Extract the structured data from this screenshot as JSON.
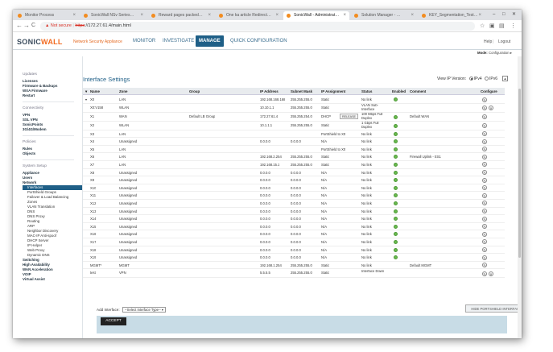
{
  "browser": {
    "tabs": [
      {
        "label": "Monitor Process"
      },
      {
        "label": "SonicWall NSv Series…"
      },
      {
        "label": "Reward pages packed…"
      },
      {
        "label": "One ka article Redirect…"
      },
      {
        "label": "SonicWall - Administrat…"
      },
      {
        "label": "Solution Manager - …"
      },
      {
        "label": "KEY_Segmentation_Test…"
      }
    ],
    "security_label": "Not secure",
    "url_scheme": "https",
    "url_rest": "://172.27.61.4/main.html",
    "back": "←",
    "forward": "→",
    "reload": "C"
  },
  "header": {
    "logo_a": "SONIC",
    "logo_b": "WALL",
    "product": "Network Security Appliance",
    "nav": [
      "MONITOR",
      "INVESTIGATE",
      "MANAGE",
      "QUICK CONFIGURATION"
    ],
    "help": "Help",
    "logout": "Logout"
  },
  "mode": {
    "label": "Mode:",
    "value": "Configuration ▸"
  },
  "sidebar": {
    "updates": "Updates",
    "updates_items": [
      "Licenses",
      "Firmware & Backups",
      "WXA Firmware",
      "Restart"
    ],
    "connectivity": "Connectivity",
    "connectivity_items": [
      "VPN",
      "SSL VPN",
      "SonicPoints",
      "3G/4G/Modem"
    ],
    "policies": "Policies",
    "policies_items": [
      "Rules",
      "Objects"
    ],
    "system_setup": "System Setup",
    "sys_items": [
      "Appliance",
      "Users",
      "Network"
    ],
    "network_items": [
      "Interfaces",
      "PortShield Groups",
      "Failover & Load Balancing",
      "Zones",
      "VLAN Translation",
      "DNS",
      "DNS Proxy",
      "Routing",
      "ARP",
      "Neighbor Discovery",
      "MAC-IP Anti-spoof",
      "DHCP Server",
      "IP Helper",
      "Web Proxy",
      "Dynamic DNS"
    ],
    "bottom_items": [
      "Switching",
      "High Availability",
      "WAN Acceleration",
      "VOIP",
      "Virtual Assist"
    ]
  },
  "page": {
    "title": "Interface Settings",
    "ip_version_label": "View IP Version:",
    "ipv4": "IPv4",
    "ipv6": "IPv6",
    "selected_ip_version": "IPv4",
    "columns": [
      "Name",
      "Zone",
      "Group",
      "IP Address",
      "Subnet Mask",
      "IP Assignment",
      "Status",
      "Enabled",
      "Comment",
      "Configure"
    ],
    "rows": [
      {
        "name": "X0",
        "zone": "LAN",
        "group": "",
        "ip": "192.168.168.168",
        "mask": "255.255.255.0",
        "assign": "Static",
        "status": "No link",
        "enabled": true,
        "comment": "",
        "del": false,
        "expand": true
      },
      {
        "name": "X0:V158",
        "zone": "WLAN",
        "group": "",
        "ip": "10.10.1.1",
        "mask": "255.255.255.0",
        "assign": "Static",
        "status": "VLAN Sub-Interface",
        "enabled": false,
        "comment": "",
        "del": true,
        "indent": true
      },
      {
        "name": "X1",
        "zone": "WAN",
        "group": "Default LB Group",
        "ip": "172.27.61.4",
        "mask": "255.255.254.0",
        "assign": "DHCP",
        "release": "RELEASE",
        "status": "100 Mbps Full Duplex",
        "enabled": true,
        "comment": "Default WAN",
        "del": false
      },
      {
        "name": "X2",
        "zone": "WLAN",
        "group": "",
        "ip": "10.1.1.1",
        "mask": "255.255.255.0",
        "assign": "Static",
        "status": "1 Gbps Full Duplex",
        "enabled": true,
        "comment": "",
        "del": false
      },
      {
        "name": "X3",
        "zone": "LAN",
        "group": "",
        "ip": "",
        "mask": "",
        "assign": "PortShield to X0",
        "status": "No link",
        "enabled": true,
        "comment": "",
        "del": false
      },
      {
        "name": "X4",
        "zone": "Unassigned",
        "group": "",
        "ip": "0.0.0.0",
        "mask": "0.0.0.0",
        "assign": "N/A",
        "status": "No link",
        "enabled": true,
        "comment": "",
        "del": false
      },
      {
        "name": "X5",
        "zone": "LAN",
        "group": "",
        "ip": "",
        "mask": "",
        "assign": "PortShield to X0",
        "status": "No link",
        "enabled": true,
        "comment": "",
        "del": false
      },
      {
        "name": "X6",
        "zone": "LAN",
        "group": "",
        "ip": "192.168.2.254",
        "mask": "255.255.255.0",
        "assign": "Static",
        "status": "No link",
        "enabled": true,
        "comment": "Firewall Uplink - ES1",
        "del": false
      },
      {
        "name": "X7",
        "zone": "LAN",
        "group": "",
        "ip": "192.168.15.1",
        "mask": "255.255.255.0",
        "assign": "Static",
        "status": "No link",
        "enabled": true,
        "comment": "",
        "del": false
      },
      {
        "name": "X8",
        "zone": "Unassigned",
        "group": "",
        "ip": "0.0.0.0",
        "mask": "0.0.0.0",
        "assign": "N/A",
        "status": "No link",
        "enabled": true,
        "comment": "",
        "del": false
      },
      {
        "name": "X9",
        "zone": "Unassigned",
        "group": "",
        "ip": "0.0.0.0",
        "mask": "0.0.0.0",
        "assign": "N/A",
        "status": "No link",
        "enabled": true,
        "comment": "",
        "del": false
      },
      {
        "name": "X10",
        "zone": "Unassigned",
        "group": "",
        "ip": "0.0.0.0",
        "mask": "0.0.0.0",
        "assign": "N/A",
        "status": "No link",
        "enabled": true,
        "comment": "",
        "del": false
      },
      {
        "name": "X11",
        "zone": "Unassigned",
        "group": "",
        "ip": "0.0.0.0",
        "mask": "0.0.0.0",
        "assign": "N/A",
        "status": "No link",
        "enabled": true,
        "comment": "",
        "del": false
      },
      {
        "name": "X12",
        "zone": "Unassigned",
        "group": "",
        "ip": "0.0.0.0",
        "mask": "0.0.0.0",
        "assign": "N/A",
        "status": "No link",
        "enabled": true,
        "comment": "",
        "del": false
      },
      {
        "name": "X13",
        "zone": "Unassigned",
        "group": "",
        "ip": "0.0.0.0",
        "mask": "0.0.0.0",
        "assign": "N/A",
        "status": "No link",
        "enabled": true,
        "comment": "",
        "del": false
      },
      {
        "name": "X14",
        "zone": "Unassigned",
        "group": "",
        "ip": "0.0.0.0",
        "mask": "0.0.0.0",
        "assign": "N/A",
        "status": "No link",
        "enabled": true,
        "comment": "",
        "del": false
      },
      {
        "name": "X15",
        "zone": "Unassigned",
        "group": "",
        "ip": "0.0.0.0",
        "mask": "0.0.0.0",
        "assign": "N/A",
        "status": "No link",
        "enabled": true,
        "comment": "",
        "del": false
      },
      {
        "name": "X16",
        "zone": "Unassigned",
        "group": "",
        "ip": "0.0.0.0",
        "mask": "0.0.0.0",
        "assign": "N/A",
        "status": "No link",
        "enabled": true,
        "comment": "",
        "del": false
      },
      {
        "name": "X17",
        "zone": "Unassigned",
        "group": "",
        "ip": "0.0.0.0",
        "mask": "0.0.0.0",
        "assign": "N/A",
        "status": "No link",
        "enabled": true,
        "comment": "",
        "del": false
      },
      {
        "name": "X18",
        "zone": "Unassigned",
        "group": "",
        "ip": "0.0.0.0",
        "mask": "0.0.0.0",
        "assign": "N/A",
        "status": "No link",
        "enabled": true,
        "comment": "",
        "del": false
      },
      {
        "name": "X19",
        "zone": "Unassigned",
        "group": "",
        "ip": "0.0.0.0",
        "mask": "0.0.0.0",
        "assign": "N/A",
        "status": "No link",
        "enabled": true,
        "comment": "",
        "del": false
      },
      {
        "name": "MGMT*",
        "zone": "MGMT",
        "group": "",
        "ip": "192.168.1.254",
        "mask": "255.255.255.0",
        "assign": "Static",
        "status": "No link",
        "enabled": false,
        "comment": "Default MGMT",
        "del": false
      },
      {
        "name": "test",
        "zone": "VPN",
        "group": "",
        "ip": "5.5.5.5",
        "mask": "255.255.255.0",
        "assign": "Static",
        "status": "Interface Down",
        "enabled": false,
        "comment": "",
        "del": true
      }
    ],
    "add_interface_label": "Add Interface:",
    "add_interface_select": "--Select Interface Type--",
    "hide_portshield": "HIDE PORTSHIELD INTERFACES",
    "accept": "ACCEPT"
  }
}
